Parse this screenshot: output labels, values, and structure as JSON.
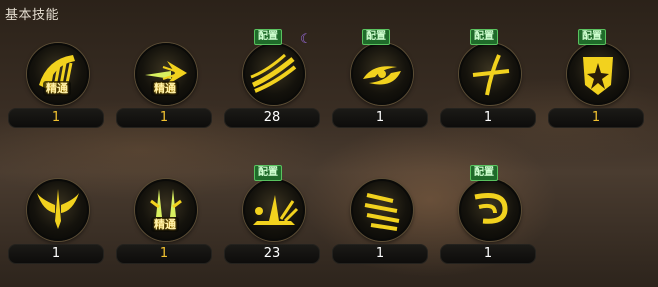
{
  "panel": {
    "title": "基本技能"
  },
  "labels": {
    "equip": "配置",
    "mastery": "精通"
  },
  "colors": {
    "icon_gold": "#f2d21e",
    "badge_green": "#1f6b2a",
    "level_gold": "#f2c230"
  },
  "rows": [
    [
      {
        "id": "s1",
        "icon": "comb-slash-icon",
        "level": "1",
        "equipped": false,
        "mastered": true,
        "level_gold": true
      },
      {
        "id": "s2",
        "icon": "dash-spear-icon",
        "level": "1",
        "equipped": false,
        "mastered": true,
        "level_gold": true
      },
      {
        "id": "s3",
        "icon": "triple-wave-icon",
        "level": "28",
        "equipped": true,
        "mastered": false,
        "level_gold": false,
        "moon": true
      },
      {
        "id": "s4",
        "icon": "cyclone-icon",
        "level": "1",
        "equipped": true,
        "mastered": false,
        "level_gold": false
      },
      {
        "id": "s5",
        "icon": "cross-slash-icon",
        "level": "1",
        "equipped": true,
        "mastered": false,
        "level_gold": false
      },
      {
        "id": "s6",
        "icon": "shield-burst-icon",
        "level": "1",
        "equipped": true,
        "mastered": false,
        "level_gold": true
      }
    ],
    [
      {
        "id": "s7",
        "icon": "winged-sword-icon",
        "level": "1",
        "equipped": false,
        "mastered": false,
        "level_gold": false
      },
      {
        "id": "s8",
        "icon": "twin-swords-icon",
        "level": "1",
        "equipped": false,
        "mastered": true,
        "level_gold": true
      },
      {
        "id": "s9",
        "icon": "ground-strike-icon",
        "level": "23",
        "equipped": true,
        "mastered": false,
        "level_gold": false
      },
      {
        "id": "s10",
        "icon": "multi-slash-icon",
        "level": "1",
        "equipped": false,
        "mastered": false,
        "level_gold": false
      },
      {
        "id": "s11",
        "icon": "swirl-wind-icon",
        "level": "1",
        "equipped": true,
        "mastered": false,
        "level_gold": false
      }
    ]
  ]
}
